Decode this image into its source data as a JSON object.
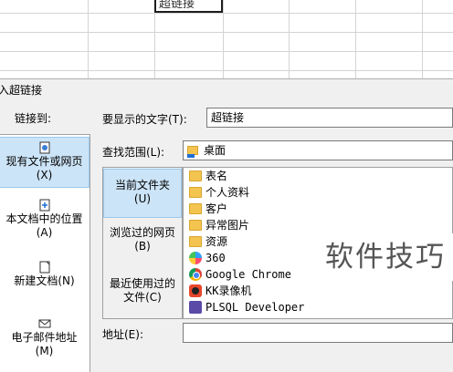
{
  "sheet": {
    "active_cell_text": "超链接"
  },
  "dialog": {
    "title": "入超链接",
    "link_to_label": "链接到:",
    "link_to_items": [
      {
        "label": "现有文件或网页",
        "accel": "(X)",
        "icon": "globe-doc-icon"
      },
      {
        "label": "本文档中的位置",
        "accel": "(A)",
        "icon": "doc-location-icon"
      },
      {
        "label": "新建文档",
        "accel": "(N)",
        "icon": "new-doc-icon"
      },
      {
        "label": "电子邮件地址",
        "accel": "(M)",
        "icon": "mail-icon"
      }
    ],
    "display_text_label": "要显示的文字(T):",
    "display_text_value": "超链接",
    "look_in_label": "查找范围(L):",
    "look_in_value": "桌面",
    "nav_items": [
      {
        "label": "当前文件夹",
        "accel": "(U)"
      },
      {
        "label": "浏览过的网页",
        "accel": "(B)"
      },
      {
        "label": "最近使用过的文件",
        "accel": "(C)"
      }
    ],
    "files": [
      {
        "name": "表名",
        "icon": "folder-icon"
      },
      {
        "name": "个人资料",
        "icon": "folder-icon"
      },
      {
        "name": "客户",
        "icon": "folder-icon"
      },
      {
        "name": "异常图片",
        "icon": "folder-icon"
      },
      {
        "name": "资源",
        "icon": "folder-icon"
      },
      {
        "name": "360",
        "icon": "app-360-icon"
      },
      {
        "name": "Google Chrome",
        "icon": "chrome-icon"
      },
      {
        "name": "KK录像机",
        "icon": "kk-recorder-icon"
      },
      {
        "name": "PLSQL Developer",
        "icon": "plsql-icon"
      }
    ],
    "address_label": "地址(E):",
    "address_value": ""
  },
  "watermark": "软件技巧"
}
